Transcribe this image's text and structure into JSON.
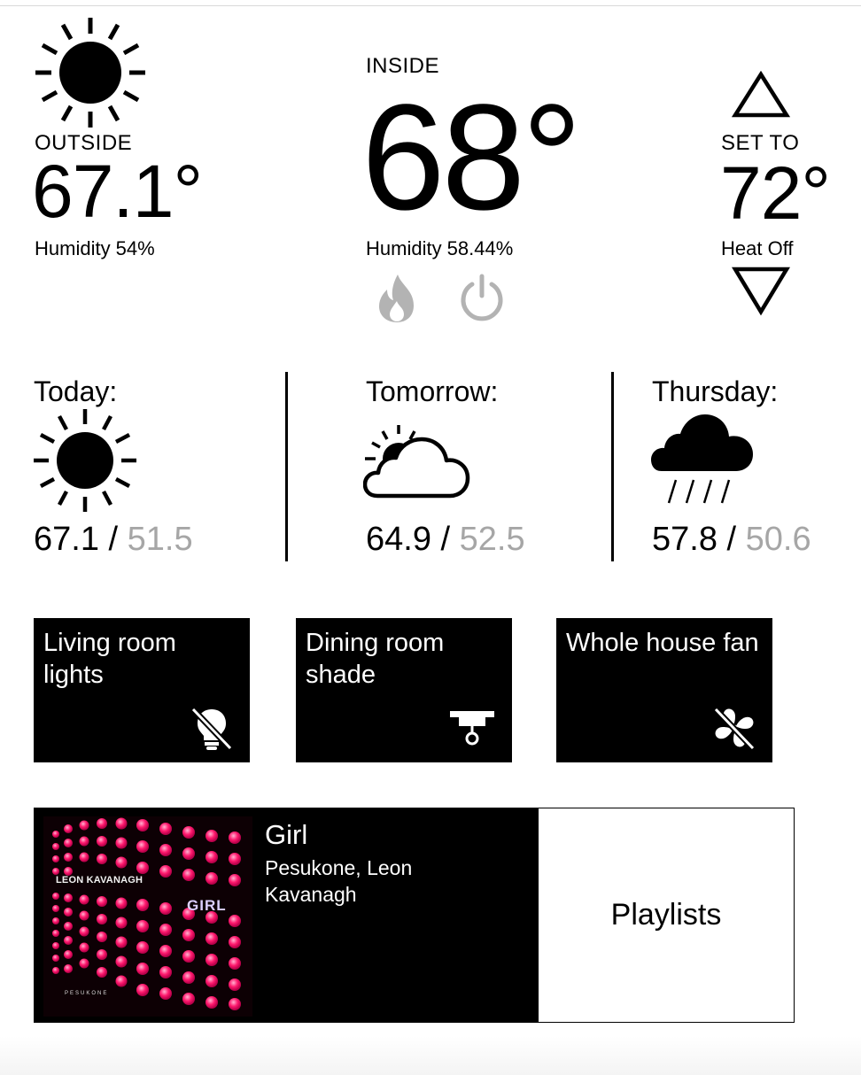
{
  "outside": {
    "icon": "sun-icon",
    "label": "OUTSIDE",
    "temp": "67.1°",
    "humidity": "Humidity 54%"
  },
  "inside": {
    "label": "INSIDE",
    "temp": "68°",
    "humidity": "Humidity 58.44%",
    "mode_icons": [
      "flame-icon",
      "power-icon"
    ]
  },
  "setpoint": {
    "label": "SET TO",
    "temp": "72°",
    "status": "Heat Off",
    "up_icon": "triangle-up-icon",
    "down_icon": "triangle-down-icon"
  },
  "forecast": [
    {
      "day": "Today:",
      "icon": "sun-icon",
      "high": "67.1",
      "sep": " / ",
      "low": "51.5"
    },
    {
      "day": "Tomorrow:",
      "icon": "partly-cloudy-icon",
      "high": "64.9",
      "sep": " / ",
      "low": "52.5"
    },
    {
      "day": "Thursday:",
      "icon": "rain-cloud-icon",
      "high": "57.8",
      "sep": " / ",
      "low": "50.6"
    }
  ],
  "tiles": [
    {
      "label": "Living room lights",
      "icon": "lightbulb-off-icon"
    },
    {
      "label": "Dining room shade",
      "icon": "shade-icon"
    },
    {
      "label": "Whole house fan",
      "icon": "fan-off-icon"
    }
  ],
  "music": {
    "title": "Girl",
    "artist": "Pesukone, Leon Kavanagh",
    "album_art_text": {
      "artist": "LEON KAVANAGH",
      "title": "GIRL",
      "label": "PESUKONE"
    },
    "playlists_label": "Playlists"
  },
  "colors": {
    "low_temp": "#a6a6a6",
    "icon_gray": "#b3b3b3",
    "album_pink": "#ff1a6e"
  }
}
